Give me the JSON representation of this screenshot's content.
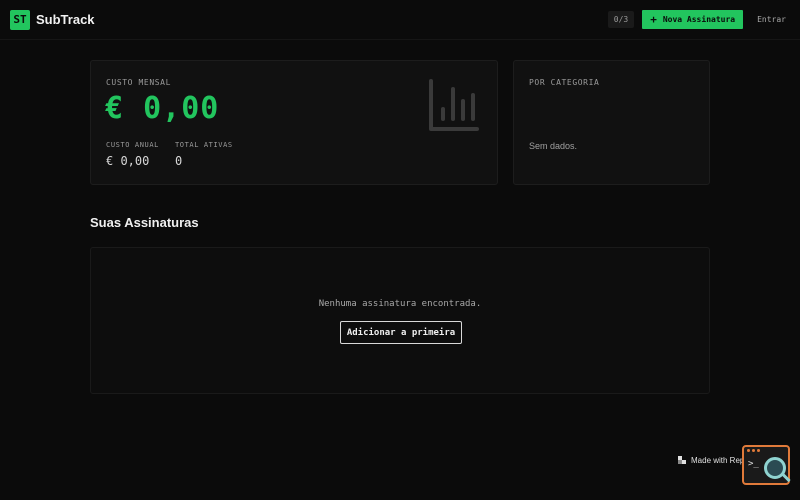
{
  "header": {
    "logo_text": "ST",
    "app_name": "SubTrack",
    "counter": "0/3",
    "new_button": "Nova Assinatura",
    "enter_link": "Entrar"
  },
  "cost_card": {
    "monthly_label": "CUSTO MENSAL",
    "monthly_value": "€ 0,00",
    "annual_label": "CUSTO ANUAL",
    "annual_value": "€ 0,00",
    "active_label": "TOTAL ATIVAS",
    "active_value": "0",
    "icon": "bar-chart-icon"
  },
  "category_card": {
    "label": "POR CATEGORIA",
    "empty_text": "Sem dados."
  },
  "subscriptions": {
    "title": "Suas Assinaturas",
    "empty_text": "Nenhuma assinatura encontrada.",
    "add_button": "Adicionar a primeira"
  },
  "badge": {
    "made_with": "Made with Replit"
  },
  "colors": {
    "accent": "#22c55e",
    "background": "#0b0b0b",
    "card": "#111111"
  }
}
